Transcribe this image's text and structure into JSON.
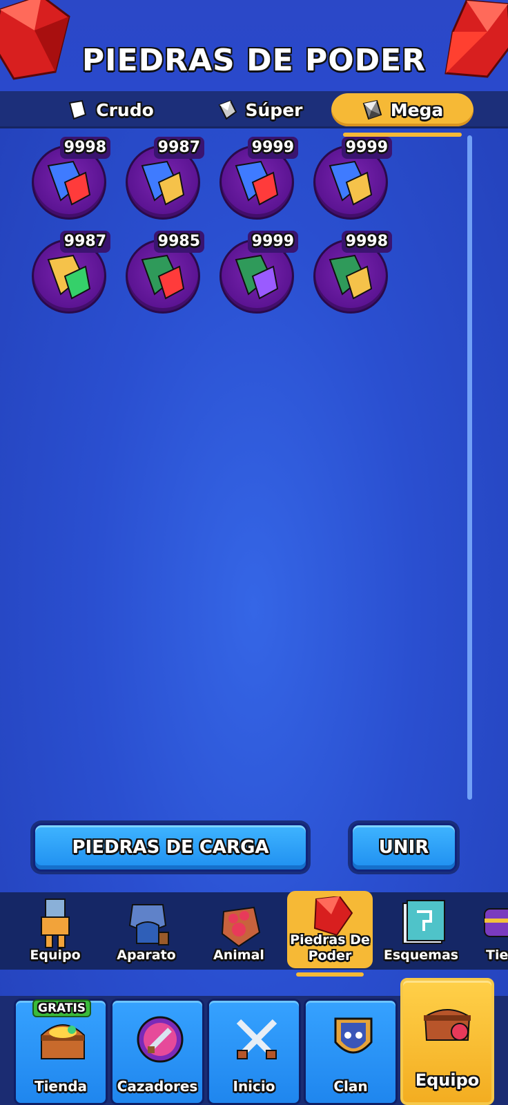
{
  "header": {
    "title": "PIEDRAS DE PODER"
  },
  "tabs": [
    {
      "label": "Crudo",
      "active": false
    },
    {
      "label": "Súper",
      "active": false
    },
    {
      "label": "Mega",
      "active": true
    }
  ],
  "stones": [
    {
      "count": "9998",
      "colors": [
        "#3f7bff",
        "#ff3b3b"
      ]
    },
    {
      "count": "9987",
      "colors": [
        "#3f7bff",
        "#f5c24a"
      ]
    },
    {
      "count": "9999",
      "colors": [
        "#3f7bff",
        "#ff3b3b"
      ]
    },
    {
      "count": "9999",
      "colors": [
        "#3f7bff",
        "#f5c24a"
      ]
    },
    {
      "count": "9987",
      "colors": [
        "#f5c24a",
        "#35d06a"
      ]
    },
    {
      "count": "9985",
      "colors": [
        "#2f9a5a",
        "#ff3b3b"
      ]
    },
    {
      "count": "9999",
      "colors": [
        "#2f9a5a",
        "#9a5bff"
      ]
    },
    {
      "count": "9998",
      "colors": [
        "#2f9a5a",
        "#f5c24a"
      ]
    }
  ],
  "actions": {
    "charge_label": "PIEDRAS DE CARGA",
    "merge_label": "UNIR"
  },
  "categories": [
    {
      "label": "Equipo",
      "icon": "armor-icon"
    },
    {
      "label": "Aparato",
      "icon": "gear-armor-icon"
    },
    {
      "label": "Animal",
      "icon": "paw-glove-icon"
    },
    {
      "label": "Piedras De Poder",
      "icon": "red-gem-icon",
      "active": true
    },
    {
      "label": "Esquemas",
      "icon": "blueprint-icon"
    },
    {
      "label": "Tie Espe",
      "icon": "chest-icon"
    }
  ],
  "nav": [
    {
      "label": "Tienda",
      "badge": "GRATIS",
      "icon": "treasure-chest-icon"
    },
    {
      "label": "Cazadores",
      "icon": "hunter-portrait-icon"
    },
    {
      "label": "Inicio",
      "icon": "crossed-swords-icon"
    },
    {
      "label": "Clan",
      "icon": "clan-shield-icon"
    },
    {
      "label": "Equipo",
      "icon": "backpack-icon",
      "active": true
    }
  ],
  "colors": {
    "accent": "#f6b936",
    "background": "#2a4fd0",
    "stone_disc": "#5a1391"
  }
}
